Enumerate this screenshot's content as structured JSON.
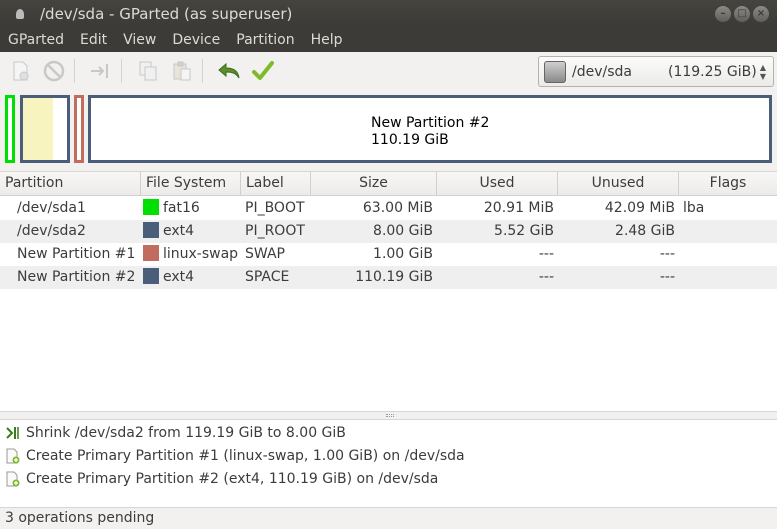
{
  "window": {
    "title": "/dev/sda - GParted (as superuser)"
  },
  "menubar": {
    "items": [
      "GParted",
      "Edit",
      "View",
      "Device",
      "Partition",
      "Help"
    ]
  },
  "toolbar": {
    "buttons": [
      {
        "icon": "new-partition-icon",
        "enabled": false
      },
      {
        "icon": "delete-icon",
        "enabled": false
      },
      {
        "icon": "resize-move-icon",
        "enabled": false
      },
      {
        "icon": "copy-icon",
        "enabled": false
      },
      {
        "icon": "paste-icon",
        "enabled": false
      },
      {
        "icon": "undo-icon",
        "enabled": true
      },
      {
        "icon": "apply-icon",
        "enabled": true
      }
    ],
    "device_selector": {
      "device": "/dev/sda",
      "size": "(119.25 GiB)"
    }
  },
  "partition_map": {
    "selected_label": "New Partition #2",
    "selected_size": "110.19 GiB",
    "colors": {
      "fat16": "#00e000",
      "ext4": "#4b5e79",
      "linux-swap": "#c06c5e",
      "used": "#f8f4c0"
    }
  },
  "table": {
    "columns": [
      "Partition",
      "File System",
      "Label",
      "Size",
      "Used",
      "Unused",
      "Flags"
    ],
    "rows": [
      {
        "partition": "/dev/sda1",
        "filesystem": "fat16",
        "fs_color": "#00e000",
        "label": "PI_BOOT",
        "size": "63.00 MiB",
        "used": "20.91 MiB",
        "unused": "42.09 MiB",
        "flags": "lba"
      },
      {
        "partition": "/dev/sda2",
        "filesystem": "ext4",
        "fs_color": "#4b5e79",
        "label": "PI_ROOT",
        "size": "8.00 GiB",
        "used": "5.52 GiB",
        "unused": "2.48 GiB",
        "flags": ""
      },
      {
        "partition": "New Partition #1",
        "filesystem": "linux-swap",
        "fs_color": "#c06c5e",
        "label": "SWAP",
        "size": "1.00 GiB",
        "used": "---",
        "unused": "---",
        "flags": ""
      },
      {
        "partition": "New Partition #2",
        "filesystem": "ext4",
        "fs_color": "#4b5e79",
        "label": "SPACE",
        "size": "110.19 GiB",
        "used": "---",
        "unused": "---",
        "flags": ""
      }
    ]
  },
  "operations": [
    {
      "icon": "shrink-icon",
      "text": "Shrink /dev/sda2 from 119.19 GiB to 8.00 GiB"
    },
    {
      "icon": "create-partition-icon",
      "text": "Create Primary Partition #1 (linux-swap, 1.00 GiB) on /dev/sda"
    },
    {
      "icon": "create-partition-icon",
      "text": "Create Primary Partition #2 (ext4, 110.19 GiB) on /dev/sda"
    }
  ],
  "status": {
    "text": "3 operations pending"
  }
}
